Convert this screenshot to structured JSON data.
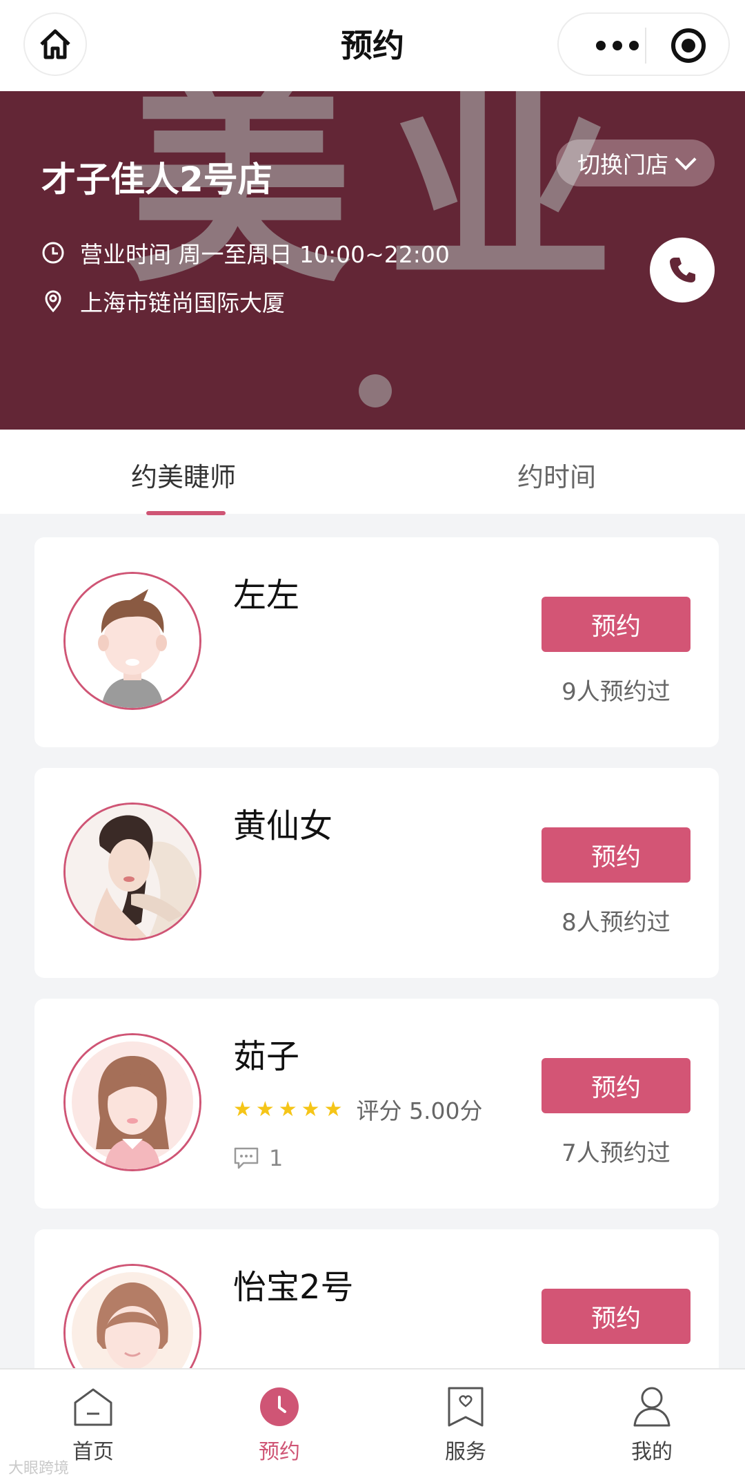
{
  "nav": {
    "title": "预约"
  },
  "store": {
    "name": "才子佳人2号店",
    "switch_label": "切换门店",
    "hours": "营业时间 周一至周日 10:00~22:00",
    "address": "上海市链尚国际大厦",
    "watermark_chars": [
      "美",
      "业"
    ]
  },
  "tabs": [
    {
      "label": "约美睫师",
      "active": true
    },
    {
      "label": "约时间",
      "active": false
    }
  ],
  "stylists": [
    {
      "name": "左左",
      "button": "预约",
      "count_text": "9人预约过"
    },
    {
      "name": "黄仙女",
      "button": "预约",
      "count_text": "8人预约过"
    },
    {
      "name": "茹子",
      "button": "预约",
      "count_text": "7人预约过",
      "stars": 5,
      "rating_text": "评分 5.00分",
      "comments": "1"
    },
    {
      "name": "怡宝2号",
      "button": "预约"
    }
  ],
  "tabbar": [
    {
      "label": "首页",
      "icon": "home-outline-icon"
    },
    {
      "label": "预约",
      "icon": "clock-icon",
      "active": true
    },
    {
      "label": "服务",
      "icon": "heart-bookmark-icon"
    },
    {
      "label": "我的",
      "icon": "user-icon"
    }
  ],
  "watermark": "大眼跨境",
  "colors": {
    "accent": "#d35575",
    "banner": "#632636"
  }
}
